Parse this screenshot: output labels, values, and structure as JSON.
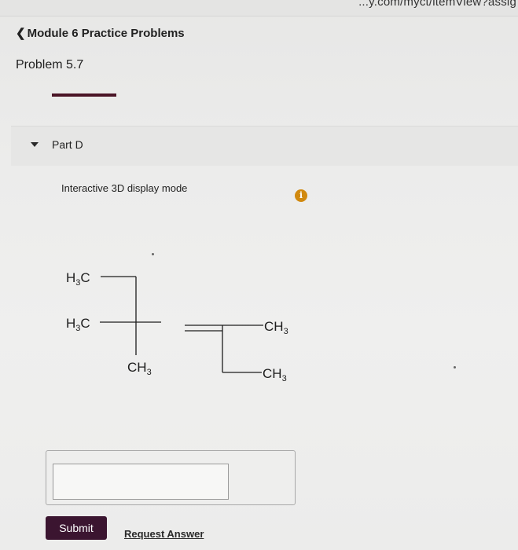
{
  "browser": {
    "url_fragment": "...y.com/myct/itemView?assig"
  },
  "breadcrumb": {
    "label": "Module 6 Practice Problems",
    "icon": "chevron-left-icon"
  },
  "problem": {
    "title": "Problem 5.7"
  },
  "part": {
    "label": "Part D",
    "toggle_icon": "caret-down-icon"
  },
  "viewer": {
    "mode_label": "Interactive 3D display mode",
    "info_icon": "info-icon",
    "info_color": "#d1890f"
  },
  "structure": {
    "labels": {
      "upper_left": "H3C",
      "lower_left": "H3C",
      "bottom_left": "CH3",
      "right_upper": "CH3",
      "right_lower": "CH3"
    }
  },
  "answer": {
    "value": "",
    "placeholder": ""
  },
  "actions": {
    "submit_label": "Submit",
    "request_label": "Request Answer"
  },
  "colors": {
    "accent": "#3b1530",
    "underline": "#4a1426"
  }
}
